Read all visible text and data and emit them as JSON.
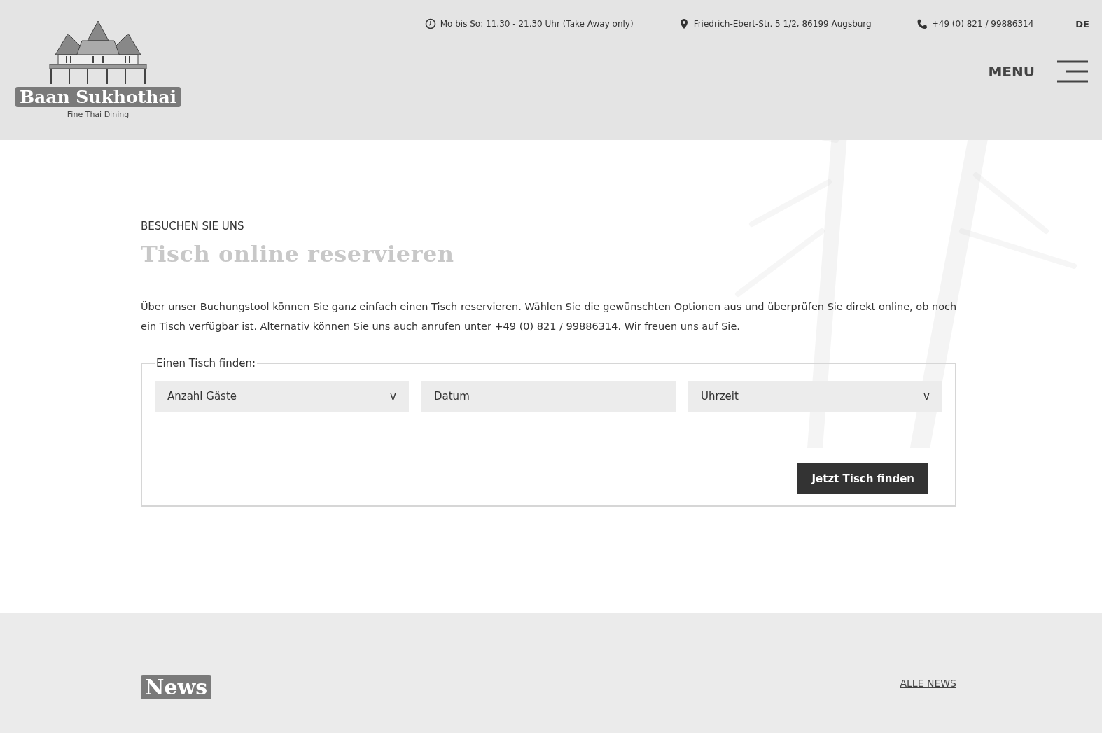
{
  "header": {
    "logo": {
      "name": "Baan Sukhothai",
      "tagline": "Fine Thai Dining"
    },
    "info": [
      {
        "kind": "clock",
        "text": "Mo bis So: 11.30 - 21.30 Uhr (Take Away only)"
      },
      {
        "kind": "pin",
        "text": "Friedrich-Ebert-Str. 5 1/2, 86199 Augsburg"
      },
      {
        "kind": "phone",
        "text": "+49 (0) 821 / 99886314"
      }
    ],
    "languages": [
      {
        "label": "DE",
        "selected": true
      }
    ],
    "menu_label": "MENU"
  },
  "reservation": {
    "eyebrow": "BESUCHEN SIE UNS",
    "title": "Tisch online reservieren",
    "intro": "Über unser Buchungstool können Sie ganz einfach einen Tisch reservieren. Wählen Sie die gewünschten Optionen aus und überprüfen Sie direkt online, ob noch ein Tisch verfügbar ist. Alternativ können Sie uns auch anrufen unter +49 (0) 821 / 99886314. Wir freuen uns auf Sie.",
    "legend": "Einen Tisch finden:",
    "fields": [
      {
        "kind": "select",
        "label": "Anzahl Gäste",
        "caret": "v"
      },
      {
        "kind": "input",
        "placeholder": "Datum"
      },
      {
        "kind": "select",
        "label": "Uhrzeit",
        "caret": "v"
      }
    ],
    "submit": "Jetzt Tisch finden"
  },
  "news": {
    "title": "News",
    "link": "ALLE NEWS"
  }
}
